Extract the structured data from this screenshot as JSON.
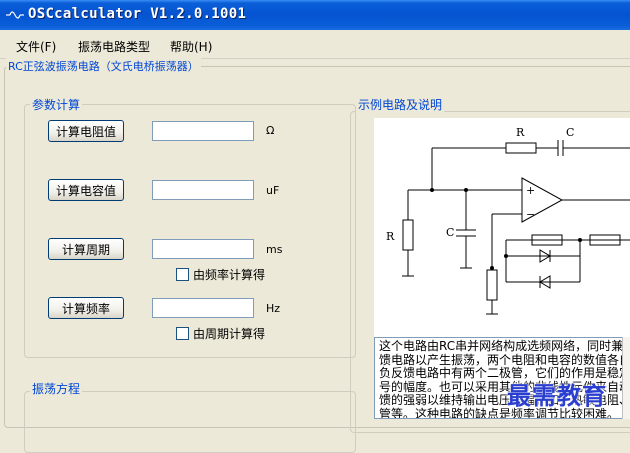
{
  "window": {
    "title": "OSCcalculator V1.2.0.1001"
  },
  "menu": [
    {
      "label": "文件(F)"
    },
    {
      "label": "振荡电路类型"
    },
    {
      "label": "帮助(H)"
    }
  ],
  "main_group": {
    "title": "RC正弦波振荡电路（文氏电桥振荡器）"
  },
  "params": {
    "title": "参数计算",
    "resistance": {
      "button": "计算电阻值",
      "value": "",
      "unit": "Ω"
    },
    "capacitance": {
      "button": "计算电容值",
      "value": "",
      "unit": "uF"
    },
    "period": {
      "button": "计算周期",
      "value": "",
      "unit": "ms",
      "checkbox_label": "由频率计算得",
      "checked": false
    },
    "frequency": {
      "button": "计算频率",
      "value": "",
      "unit": "Hz",
      "checkbox_label": "由周期计算得",
      "checked": false
    }
  },
  "example": {
    "title": "示例电路及说明",
    "labels": {
      "r_top": "R",
      "r_left": "R",
      "c_top": "C",
      "c_left": "C",
      "plus": "+",
      "minus": "−"
    },
    "description": "这个电路由RC串并网络构成选频网络，同时兼作正反馈电路以产生振荡，两个电阻和电容的数值各自相等。负反馈电路中有两个二极管，它们的作用是稳定输出信号的幅度。也可以采用其他的非线性元件来自动调整反馈的强弱以维持输出电压恒幅，如：热敏电阻、场效应管等。这种电路的缺点是频率调节比较困难。"
  },
  "equation": {
    "title": "振荡方程"
  },
  "watermark": "最需教育"
}
